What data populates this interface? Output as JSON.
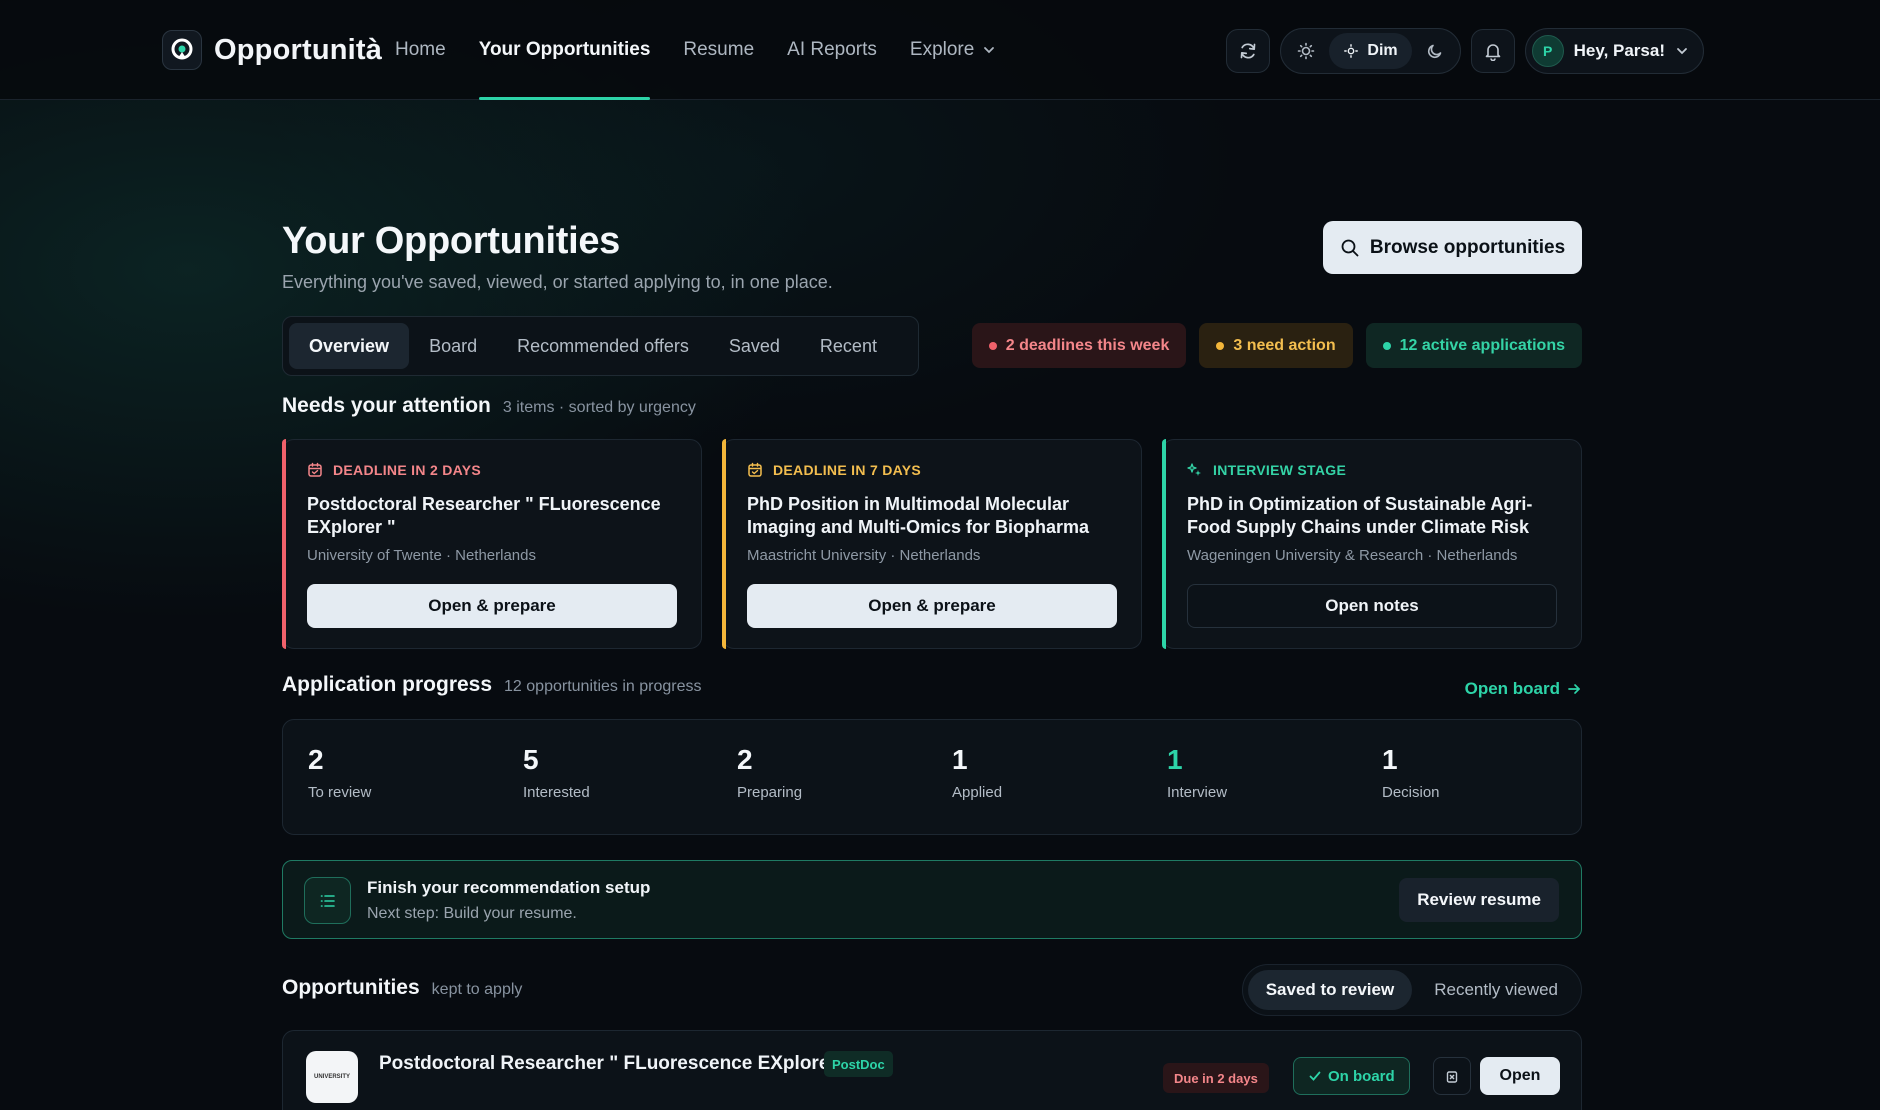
{
  "nav": {
    "brand": "Opportunità",
    "links": [
      "Home",
      "Your Opportunities",
      "Resume",
      "AI Reports",
      "Explore"
    ],
    "theme_dim_label": "Dim",
    "greeting": "Hey, Parsa!",
    "avatar_initial": "P"
  },
  "page": {
    "title": "Your Opportunities",
    "subtitle": "Everything you've saved, viewed, or started applying to, in one place.",
    "browse_label": "Browse opportunities"
  },
  "tabs": [
    "Overview",
    "Board",
    "Recommended offers",
    "Saved",
    "Recent"
  ],
  "badges": {
    "deadlines": "2 deadlines this week",
    "need_action": "3 need action",
    "active": "12 active applications"
  },
  "attention": {
    "title": "Needs your attention",
    "meta": "3 items · sorted by urgency",
    "cards": [
      {
        "tag": "DEADLINE IN 2 DAYS",
        "title": "Postdoctoral Researcher \" FLuorescence EXplorer \"",
        "sub": "University of Twente · Netherlands",
        "button": "Open & prepare"
      },
      {
        "tag": "DEADLINE IN 7 DAYS",
        "title": "PhD Position in Multimodal Molecular Imaging and Multi-Omics for Biopharma",
        "sub": "Maastricht University · Netherlands",
        "button": "Open & prepare"
      },
      {
        "tag": "INTERVIEW STAGE",
        "title": "PhD in Optimization of Sustainable Agri-Food Supply Chains under Climate Risk",
        "sub": "Wageningen University & Research · Netherlands",
        "button": "Open notes"
      }
    ]
  },
  "progress": {
    "title": "Application progress",
    "meta": "12 opportunities in progress",
    "open_board": "Open board",
    "stages": [
      {
        "count": "2",
        "label": "To review"
      },
      {
        "count": "5",
        "label": "Interested"
      },
      {
        "count": "2",
        "label": "Preparing"
      },
      {
        "count": "1",
        "label": "Applied"
      },
      {
        "count": "1",
        "label": "Interview"
      },
      {
        "count": "1",
        "label": "Decision"
      }
    ]
  },
  "setup": {
    "title": "Finish your recommendation setup",
    "sub": "Next step: Build your resume.",
    "button": "Review resume"
  },
  "opportunities": {
    "title": "Opportunities",
    "meta": "kept to apply",
    "segments": [
      "Saved to review",
      "Recently viewed"
    ],
    "row": {
      "logo_text": "UNIVERSITY",
      "title": "Postdoctoral Researcher \" FLuorescence EXplorer \"",
      "type": "PostDoc",
      "due": "Due in 2 days",
      "onboard": "On board",
      "open": "Open"
    }
  },
  "colors": {
    "accent": "#2dd4a8",
    "danger": "#f0616b",
    "warning": "#f3b63a"
  }
}
